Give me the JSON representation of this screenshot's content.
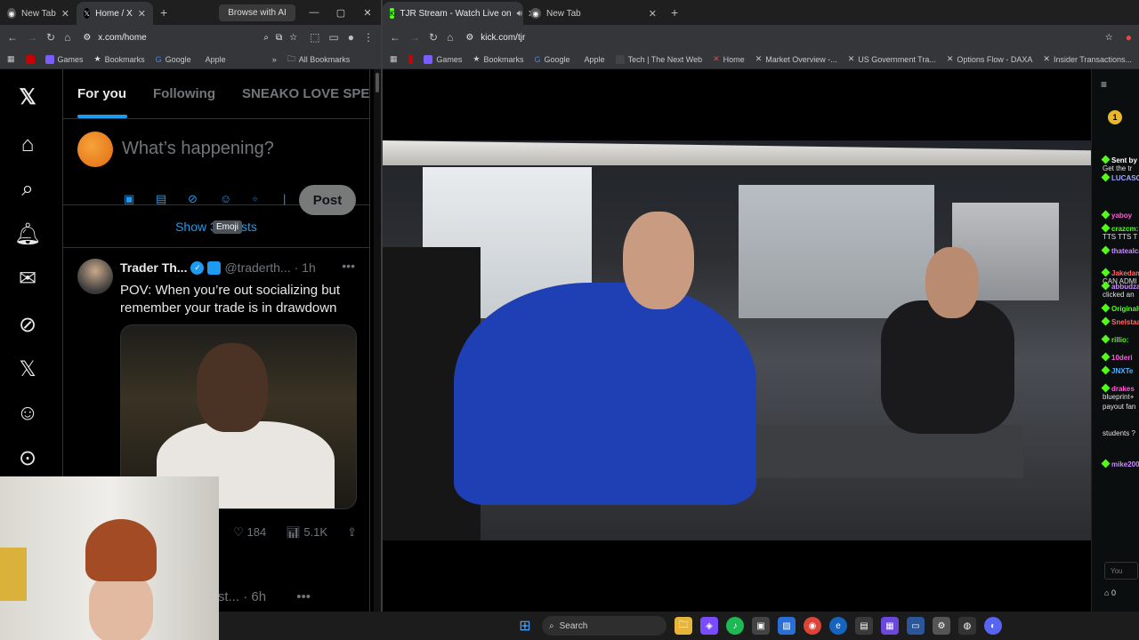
{
  "left_browser": {
    "tabs": [
      {
        "title": "New Tab",
        "active": false
      },
      {
        "title": "Home / X",
        "active": true
      }
    ],
    "browse_ai": "Browse with AI",
    "url": "x.com/home",
    "bookmarks": [
      "Games",
      "Bookmarks",
      "Google",
      "Apple"
    ],
    "all_bookmarks": "All Bookmarks"
  },
  "right_browser": {
    "tabs": [
      {
        "title": "TJR Stream - Watch Live on",
        "active": true
      },
      {
        "title": "New Tab",
        "active": false
      }
    ],
    "url": "kick.com/tjr",
    "bookmarks": [
      "Games",
      "Bookmarks",
      "Google",
      "Apple",
      "Tech | The Next Web",
      "Home",
      "Market Overview -...",
      "US Government Tra...",
      "Options Flow - DAXA",
      "Insider Transactions..."
    ]
  },
  "x": {
    "tabs": [
      "For you",
      "Following",
      "SNEAKO LOVE SPEEC"
    ],
    "compose_placeholder": "What’s happening?",
    "post_label": "Post",
    "tooltip": "Emoji",
    "show_posts": "Show 35 posts",
    "tweet": {
      "name": "Trader Th...",
      "handle": "@traderth...",
      "time": "· 1h",
      "text": "POV: When you’re out socializing but remember your trade is in drawdown",
      "likes": "184",
      "views": "5.1K"
    },
    "tweet2_handle": "@Hardest...",
    "tweet2_time": "· 6h"
  },
  "kick": {
    "chat": [
      {
        "user": "Sent by",
        "color": "#ffffff",
        "text": "Get the tr"
      },
      {
        "user": "LUCASO3",
        "color": "#9fa8ff",
        "text": ""
      },
      {
        "user": "yaboy",
        "color": "#ff5cd6",
        "text": ""
      },
      {
        "user": "crazcm:",
        "color": "#53fc18",
        "text": "TTS TTS T"
      },
      {
        "user": "thatealcap",
        "color": "#c98bff",
        "text": ""
      },
      {
        "user": "Jakedam",
        "color": "#ff6b6b",
        "text": "CAN ADMI"
      },
      {
        "user": "abbudzab",
        "color": "#c98bff",
        "text": "clicked an"
      },
      {
        "user": "Original05",
        "color": "#53fc18",
        "text": ""
      },
      {
        "user": "Snelstaag",
        "color": "#ff6b6b",
        "text": ""
      },
      {
        "user": "rillio:",
        "color": "#53fc18",
        "text": ""
      },
      {
        "user": "10deri",
        "color": "#ff5cd6",
        "text": ""
      },
      {
        "user": "JNXTe",
        "color": "#4db2ff",
        "text": ""
      },
      {
        "user": "drakes",
        "color": "#ff5cd6",
        "text": "blueprint+"
      },
      {
        "user": "",
        "color": "#e0e0e0",
        "text": "payout fan"
      },
      {
        "user": "",
        "color": "#e0e0e0",
        "text": "students ?"
      },
      {
        "user": "mike2000",
        "color": "#c98bff",
        "text": ""
      }
    ],
    "chat_input_placeholder": "You",
    "viewer_count": "0",
    "rank": "1"
  },
  "taskbar": {
    "search_placeholder": "Search"
  },
  "colors": {
    "x_blue": "#1d9bf0",
    "kick_green": "#53fc18",
    "post_button": "#787a7a"
  }
}
